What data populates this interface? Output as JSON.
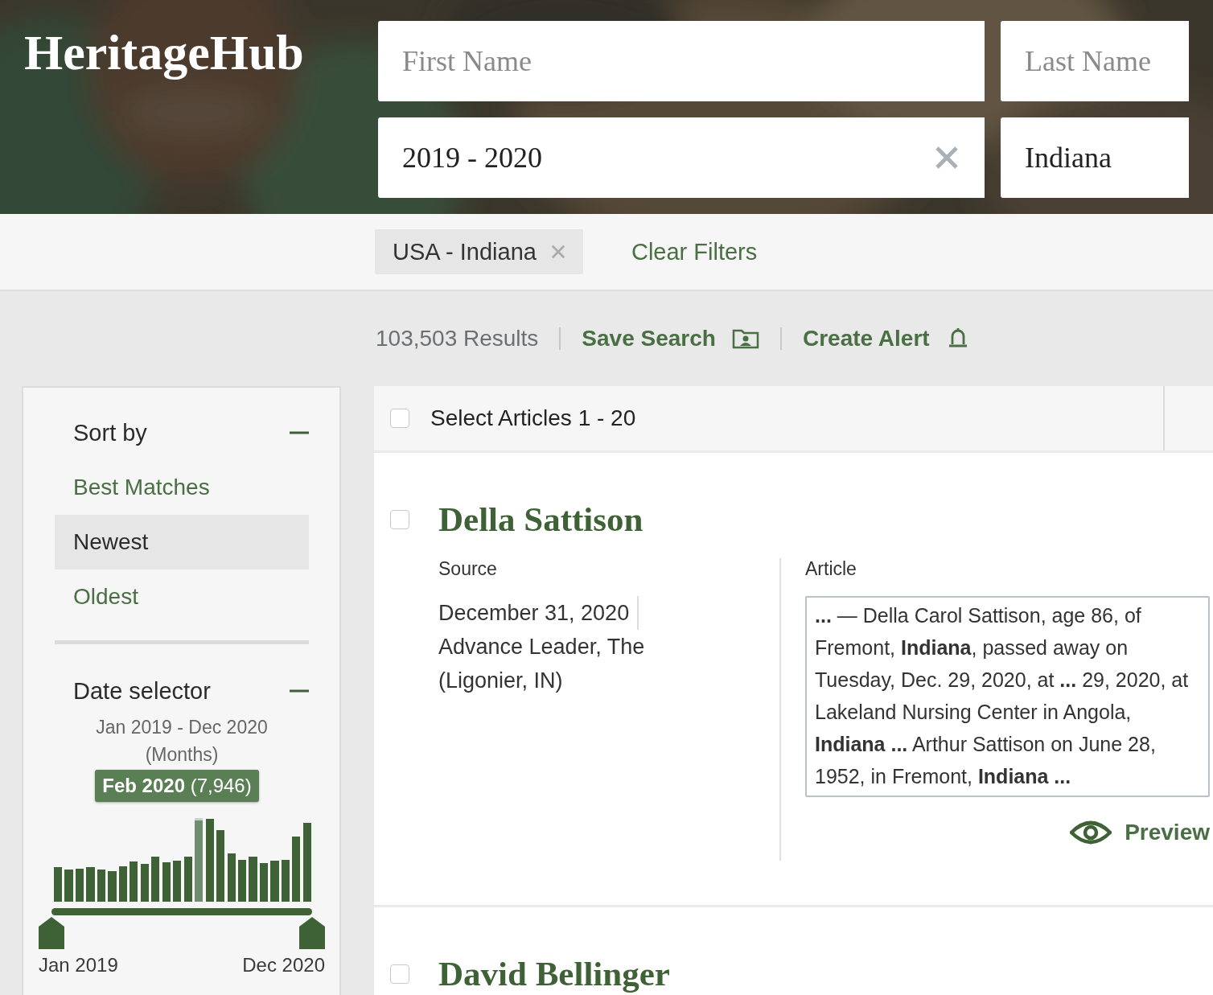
{
  "logo": "HeritageHub",
  "search": {
    "fields": [
      {
        "placeholder": "First Name",
        "clearable": false
      },
      {
        "placeholder": "Last Name",
        "clearable": false
      },
      {
        "value": "2019 - 2020",
        "clearable": true
      },
      {
        "value": "Indiana",
        "clearable": false
      }
    ]
  },
  "filters": {
    "chips": [
      {
        "label": "USA - Indiana"
      }
    ],
    "clear": "Clear Filters"
  },
  "results_bar": {
    "count": "103,503 Results",
    "save": "Save Search",
    "alert": "Create Alert"
  },
  "sidebar": {
    "sort": {
      "title": "Sort by",
      "expanded": true,
      "options": [
        {
          "label": "Best Matches",
          "selected": false
        },
        {
          "label": "Newest",
          "selected": true
        },
        {
          "label": "Oldest",
          "selected": false
        }
      ]
    },
    "date": {
      "title": "Date selector",
      "expanded": true,
      "range": "Jan 2019 - Dec 2020 (Months)",
      "tooltip": "**Feb 2020** (7,946)",
      "start": "Jan 2019",
      "end": "Dec 2020",
      "bars": [
        {
          "selected": false
        },
        {
          "selected": false
        },
        {
          "selected": false
        },
        {
          "selected": false
        },
        {
          "selected": false
        },
        {
          "selected": false
        },
        {
          "selected": false
        },
        {
          "selected": false
        },
        {
          "selected": false
        },
        {
          "selected": false
        },
        {
          "selected": false
        },
        {
          "selected": false
        },
        {
          "selected": false
        },
        {
          "selected": true
        },
        {
          "selected": false
        },
        {
          "selected": false
        },
        {
          "selected": false
        },
        {
          "selected": false
        },
        {
          "selected": false
        },
        {
          "selected": false
        },
        {
          "selected": false
        },
        {
          "selected": false
        },
        {
          "selected": false
        },
        {
          "selected": false
        }
      ]
    }
  },
  "list": {
    "select_all": {
      "label": "Select Articles 1 - 20",
      "checked": false
    },
    "results": [
      {
        "title": "Della Sattison",
        "checked": false,
        "source_label": "Source",
        "date": "December 31, 2020",
        "publication": "Advance Leader, The (Ligonier, IN)",
        "article_label": "Article",
        "snippet": "**...** — Della Carol Sattison, age 86, of Fremont, **Indiana**, passed away on Tuesday, Dec. 29, 2020, at **...** 29, 2020, at Lakeland Nursing Center in Angola, **Indiana** **...** Arthur Sattison on June 28, 1952, in Fremont, **Indiana** **...**",
        "preview": "Preview"
      },
      {
        "title": "David Bellinger",
        "checked": false
      }
    ]
  }
}
